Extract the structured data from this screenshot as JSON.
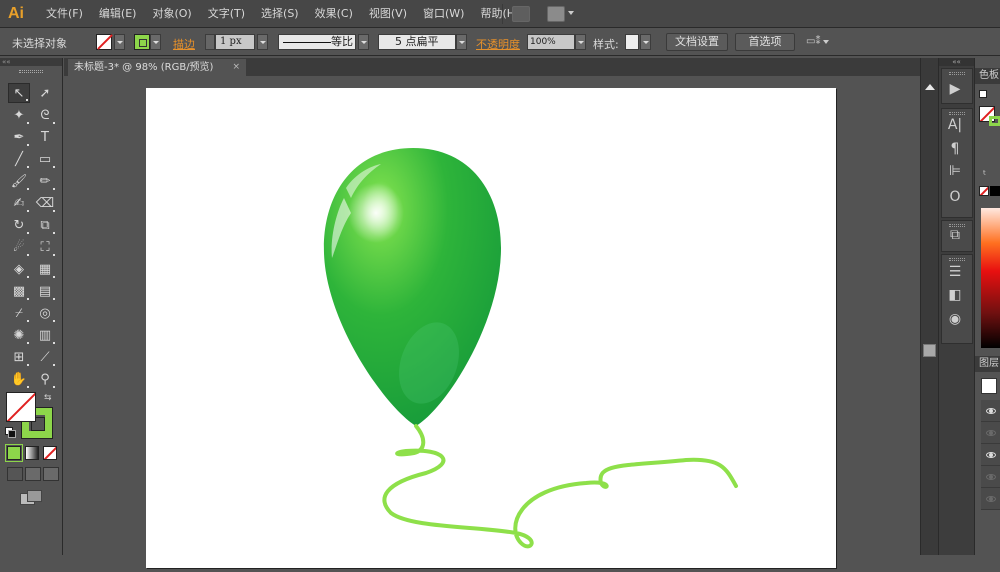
{
  "app": {
    "logo": "Ai"
  },
  "menu": {
    "items": [
      "文件(F)",
      "编辑(E)",
      "对象(O)",
      "文字(T)",
      "选择(S)",
      "效果(C)",
      "视图(V)",
      "窗口(W)",
      "帮助(H)"
    ],
    "bridge_icon": "bridge-icon",
    "workspace_icon": "workspace-switcher-icon"
  },
  "control_bar": {
    "selection_status": "未选择对象",
    "stroke_label": "描边",
    "stroke_weight": "1 px",
    "stroke_profile": "等比",
    "brush": "5 点扁平",
    "opacity_label": "不透明度",
    "opacity_value": "100%",
    "style_label": "样式:",
    "doc_setup_button": "文档设置",
    "preferences_button": "首选项",
    "fill_color": "none",
    "stroke_color": "#8dd64a"
  },
  "document": {
    "tab_title": "未标题-3* @ 98% (RGB/预览)",
    "close_glyph": "×"
  },
  "toolbox": {
    "collapse_glyph": "««",
    "tools": [
      {
        "name": "selection-tool",
        "glyph": "↖",
        "selected": true
      },
      {
        "name": "direct-selection-tool",
        "glyph": "➚"
      },
      {
        "name": "magic-wand-tool",
        "glyph": "✦"
      },
      {
        "name": "lasso-tool",
        "glyph": "ᘓ"
      },
      {
        "name": "pen-tool",
        "glyph": "✒"
      },
      {
        "name": "type-tool",
        "glyph": "T"
      },
      {
        "name": "line-segment-tool",
        "glyph": "╱"
      },
      {
        "name": "rectangle-tool",
        "glyph": "▭"
      },
      {
        "name": "paintbrush-tool",
        "glyph": "🖌"
      },
      {
        "name": "pencil-tool",
        "glyph": "✏"
      },
      {
        "name": "blob-brush-tool",
        "glyph": "✍"
      },
      {
        "name": "eraser-tool",
        "glyph": "⌫"
      },
      {
        "name": "rotate-tool",
        "glyph": "↻"
      },
      {
        "name": "scale-tool",
        "glyph": "⧉"
      },
      {
        "name": "warp-tool",
        "glyph": "☄"
      },
      {
        "name": "free-transform-tool",
        "glyph": "⛶"
      },
      {
        "name": "shape-builder-tool",
        "glyph": "◈"
      },
      {
        "name": "perspective-grid-tool",
        "glyph": "▦"
      },
      {
        "name": "mesh-tool",
        "glyph": "▩"
      },
      {
        "name": "gradient-tool",
        "glyph": "▤"
      },
      {
        "name": "eyedropper-tool",
        "glyph": "⌿"
      },
      {
        "name": "blend-tool",
        "glyph": "◎"
      },
      {
        "name": "symbol-sprayer-tool",
        "glyph": "✺"
      },
      {
        "name": "column-graph-tool",
        "glyph": "▥"
      },
      {
        "name": "artboard-tool",
        "glyph": "⊞"
      },
      {
        "name": "slice-tool",
        "glyph": "⟋"
      },
      {
        "name": "hand-tool",
        "glyph": "✋"
      },
      {
        "name": "zoom-tool",
        "glyph": "⚲"
      }
    ],
    "swap_glyph": "⇆"
  },
  "dock": {
    "collapse_glyph": "««",
    "icons": [
      {
        "name": "actions-play-icon",
        "glyph": "▶"
      },
      {
        "name": "character-icon",
        "glyph": "A|"
      },
      {
        "name": "paragraph-icon",
        "glyph": "¶"
      },
      {
        "name": "align-icon",
        "glyph": "⊫"
      },
      {
        "name": "opentype-icon",
        "glyph": "O"
      },
      {
        "name": "pathfinder-icon",
        "glyph": "⧉"
      },
      {
        "name": "stroke-panel-icon",
        "glyph": "☰"
      },
      {
        "name": "gradient-panel-icon",
        "glyph": "◧"
      },
      {
        "name": "transparency-panel-icon",
        "glyph": "◉"
      }
    ]
  },
  "right_panel": {
    "color_tab": "色板",
    "layers_tab": "图层",
    "layer_visibility": [
      true,
      false,
      true,
      false,
      false
    ]
  },
  "artwork": {
    "balloon_colors": {
      "light": "#6fd84a",
      "mid": "#2eb43a",
      "dark": "#169a3a"
    },
    "ribbon_color": "#8ee04a"
  }
}
